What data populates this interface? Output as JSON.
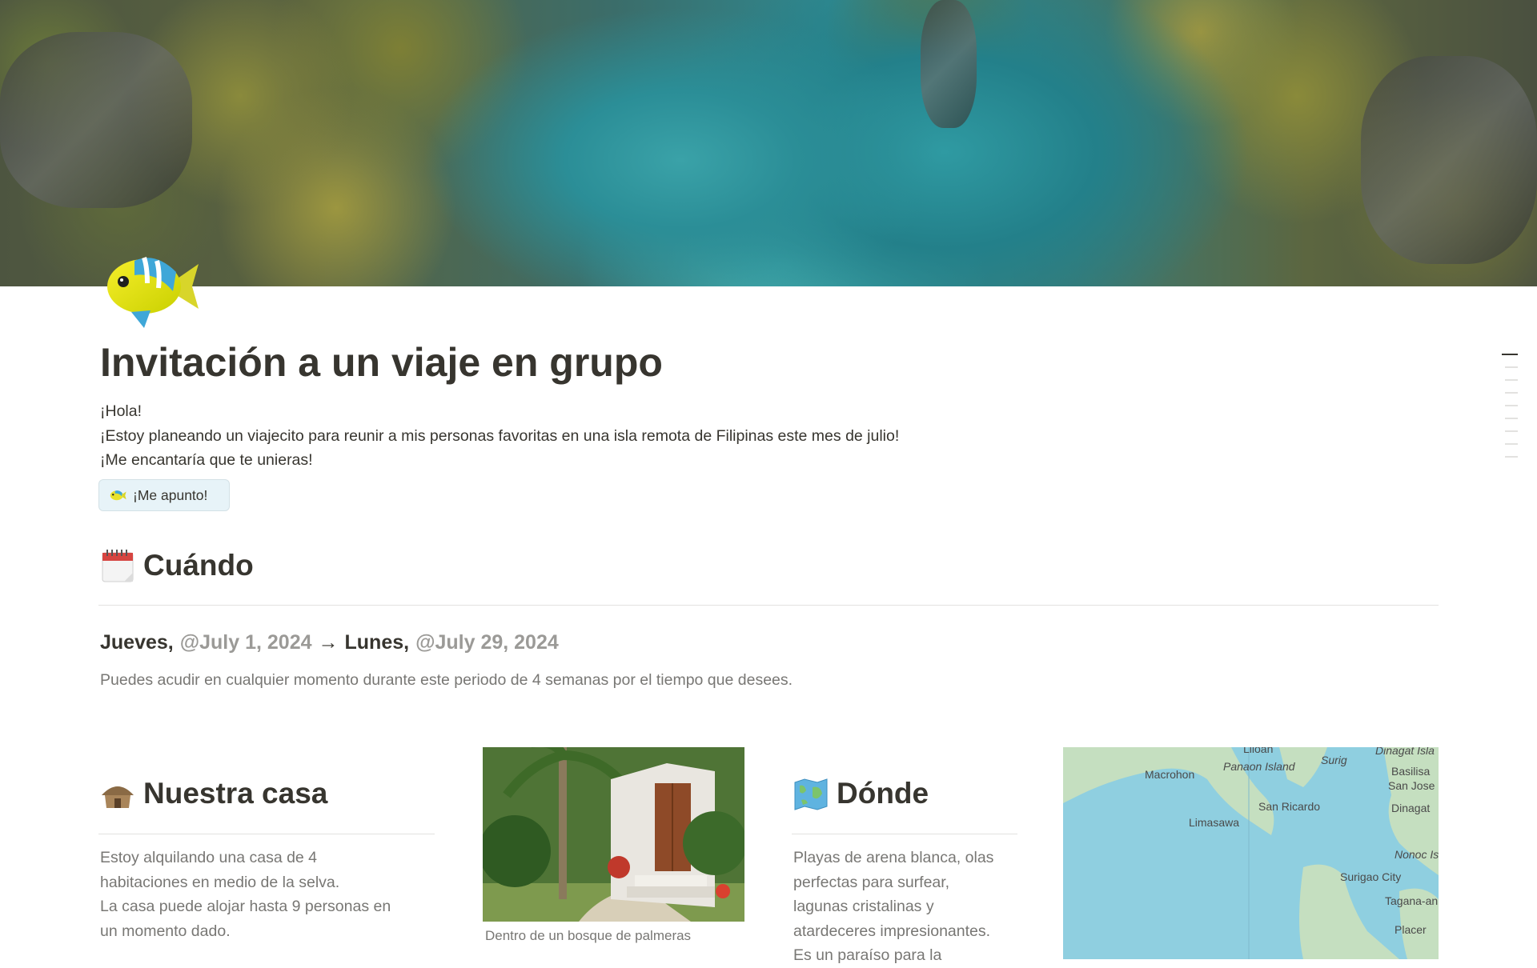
{
  "page": {
    "title": "Invitación a un viaje en grupo",
    "icon": "tropical-fish-icon",
    "intro": [
      "¡Hola!",
      "¡Estoy planeando un viajecito para reunir a mis personas favoritas en una isla remota de Filipinas este mes de julio!",
      "¡Me encantaría que te unieras!"
    ],
    "join_button": {
      "label": "¡Me apunto!",
      "icon": "tropical-fish-icon"
    }
  },
  "when": {
    "heading": "Cuándo",
    "icon": "spiral-calendar-icon",
    "start_day": "Jueves,",
    "start_date": "@July 1, 2024",
    "arrow": "→",
    "end_day": "Lunes,",
    "end_date": "@July 29, 2024",
    "note": "Puedes acudir en cualquier momento durante este periodo de 4 semanas por el tiempo que desees."
  },
  "house": {
    "heading": "Nuestra casa",
    "icon": "hut-icon",
    "text": [
      "Estoy alquilando una casa de 4",
      "habitaciones en medio de la selva.",
      "La casa puede alojar hasta 9 personas en",
      "un momento dado."
    ],
    "photo_caption": "Dentro de un bosque de palmeras"
  },
  "where": {
    "heading": "Dónde",
    "icon": "world-map-icon",
    "text": [
      "Playas de arena blanca, olas",
      "perfectas para surfear,",
      "lagunas cristalinas y",
      "atardeceres impresionantes.",
      "Es un paraíso para la"
    ],
    "map_labels": [
      "Liloan",
      "Panaon Island",
      "Macrohon",
      "San Ricardo",
      "Limasawa",
      "Surig",
      "Dinagat Isla",
      "Basilisa",
      "San Jose",
      "Dinagat",
      "Nonoc Is",
      "Surigao City",
      "Tagana-an",
      "Placer"
    ]
  },
  "colors": {
    "text": "#37352f",
    "muted": "#787774",
    "mention": "#9b9a97",
    "button_bg": "#e7f3f8",
    "map_water": "#8fcfe0",
    "map_land": "#c5dfc0"
  }
}
